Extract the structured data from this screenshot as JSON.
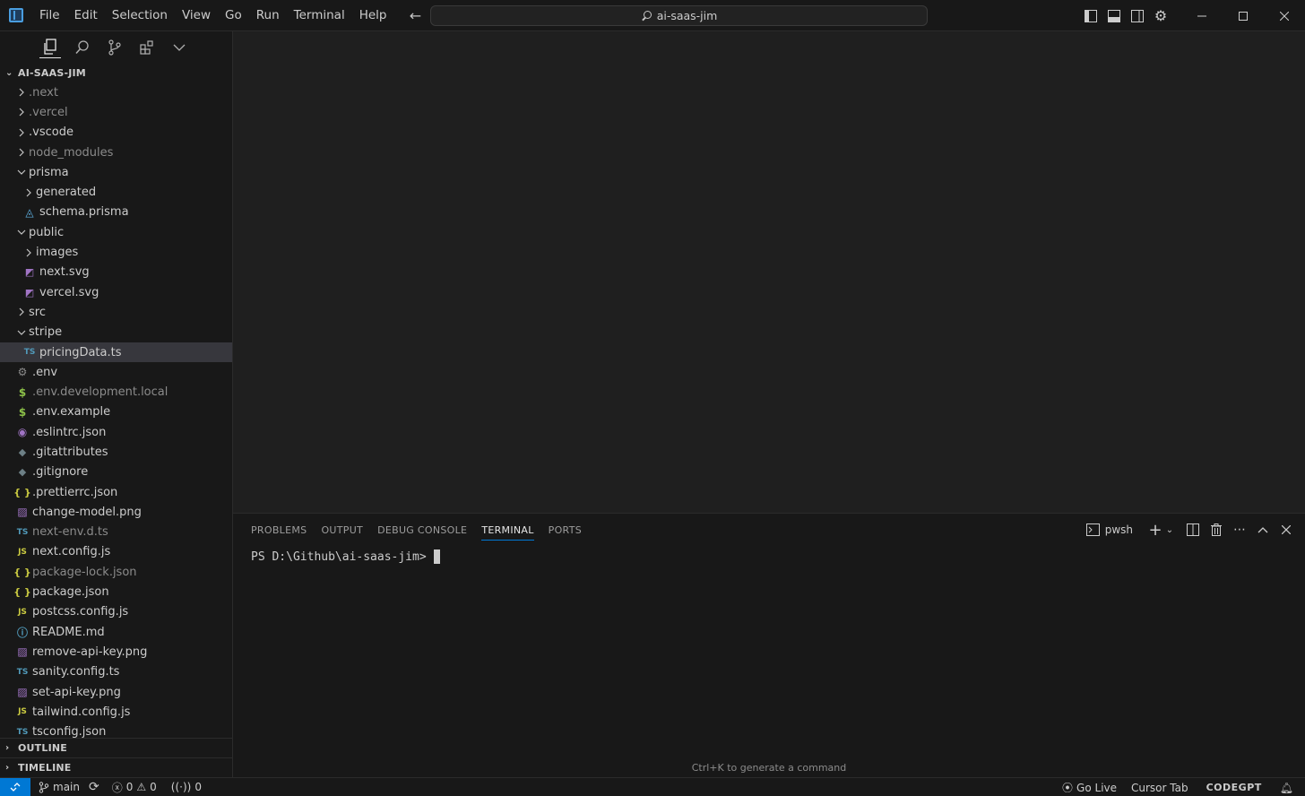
{
  "menu": [
    "File",
    "Edit",
    "Selection",
    "View",
    "Go",
    "Run",
    "Terminal",
    "Help"
  ],
  "command_center": {
    "text": "ai-saas-jim"
  },
  "explorer": {
    "root": "AI-SAAS-JIM",
    "items": [
      {
        "label": ".next",
        "type": "folder",
        "depth": 0,
        "open": false,
        "dim": true
      },
      {
        "label": ".vercel",
        "type": "folder",
        "depth": 0,
        "open": false,
        "dim": true
      },
      {
        "label": ".vscode",
        "type": "folder",
        "depth": 0,
        "open": false
      },
      {
        "label": "node_modules",
        "type": "folder",
        "depth": 0,
        "open": false,
        "dim": true
      },
      {
        "label": "prisma",
        "type": "folder",
        "depth": 0,
        "open": true
      },
      {
        "label": "generated",
        "type": "folder",
        "depth": 1,
        "open": false
      },
      {
        "label": "schema.prisma",
        "type": "file",
        "depth": 1,
        "icon": "prisma-icon",
        "glyph": "◬"
      },
      {
        "label": "public",
        "type": "folder",
        "depth": 0,
        "open": true
      },
      {
        "label": "images",
        "type": "folder",
        "depth": 1,
        "open": false
      },
      {
        "label": "next.svg",
        "type": "file",
        "depth": 1,
        "icon": "svg-icon",
        "glyph": "◩"
      },
      {
        "label": "vercel.svg",
        "type": "file",
        "depth": 1,
        "icon": "svg-icon",
        "glyph": "◩"
      },
      {
        "label": "src",
        "type": "folder",
        "depth": 0,
        "open": false
      },
      {
        "label": "stripe",
        "type": "folder",
        "depth": 0,
        "open": true
      },
      {
        "label": "pricingData.ts",
        "type": "file",
        "depth": 1,
        "icon": "typescript-icon",
        "glyph": "TS",
        "selected": true
      },
      {
        "label": ".env",
        "type": "file",
        "depth": 0,
        "icon": "gear-icon",
        "glyph": "⚙"
      },
      {
        "label": ".env.development.local",
        "type": "file",
        "depth": 0,
        "icon": "dollar-icon",
        "glyph": "$",
        "dim": true
      },
      {
        "label": ".env.example",
        "type": "file",
        "depth": 0,
        "icon": "dollar-icon",
        "glyph": "$"
      },
      {
        "label": ".eslintrc.json",
        "type": "file",
        "depth": 0,
        "icon": "eslint-icon",
        "glyph": "◉"
      },
      {
        "label": ".gitattributes",
        "type": "file",
        "depth": 0,
        "icon": "git-icon",
        "glyph": "◆"
      },
      {
        "label": ".gitignore",
        "type": "file",
        "depth": 0,
        "icon": "git-icon",
        "glyph": "◆"
      },
      {
        "label": ".prettierrc.json",
        "type": "file",
        "depth": 0,
        "icon": "json-icon",
        "glyph": "{ }"
      },
      {
        "label": "change-model.png",
        "type": "file",
        "depth": 0,
        "icon": "image-icon",
        "glyph": "▨"
      },
      {
        "label": "next-env.d.ts",
        "type": "file",
        "depth": 0,
        "icon": "typescript-icon",
        "glyph": "TS",
        "dim": true
      },
      {
        "label": "next.config.js",
        "type": "file",
        "depth": 0,
        "icon": "javascript-icon",
        "glyph": "JS"
      },
      {
        "label": "package-lock.json",
        "type": "file",
        "depth": 0,
        "icon": "json-icon",
        "glyph": "{ }",
        "dim": true
      },
      {
        "label": "package.json",
        "type": "file",
        "depth": 0,
        "icon": "json-icon",
        "glyph": "{ }"
      },
      {
        "label": "postcss.config.js",
        "type": "file",
        "depth": 0,
        "icon": "javascript-icon",
        "glyph": "JS"
      },
      {
        "label": "README.md",
        "type": "file",
        "depth": 0,
        "icon": "info-icon",
        "glyph": "ⓘ"
      },
      {
        "label": "remove-api-key.png",
        "type": "file",
        "depth": 0,
        "icon": "image-icon",
        "glyph": "▨"
      },
      {
        "label": "sanity.config.ts",
        "type": "file",
        "depth": 0,
        "icon": "typescript-icon",
        "glyph": "TS"
      },
      {
        "label": "set-api-key.png",
        "type": "file",
        "depth": 0,
        "icon": "image-icon",
        "glyph": "▨"
      },
      {
        "label": "tailwind.config.js",
        "type": "file",
        "depth": 0,
        "icon": "javascript-icon",
        "glyph": "JS"
      },
      {
        "label": "tsconfig.json",
        "type": "file",
        "depth": 0,
        "icon": "tsconfig-icon",
        "glyph": "TS"
      }
    ],
    "outline": "OUTLINE",
    "timeline": "TIMELINE"
  },
  "panel": {
    "tabs": [
      "PROBLEMS",
      "OUTPUT",
      "DEBUG CONSOLE",
      "TERMINAL",
      "PORTS"
    ],
    "active_tab": "TERMINAL",
    "shell": "pwsh",
    "prompt": "PS D:\\Github\\ai-saas-jim>",
    "hint": "Ctrl+K to generate a command"
  },
  "statusbar": {
    "branch": "main",
    "errors": "0",
    "warnings": "0",
    "ports": "0",
    "go_live": "Go Live",
    "cursor_tab": "Cursor Tab",
    "codegpt": "CODEGPT"
  }
}
